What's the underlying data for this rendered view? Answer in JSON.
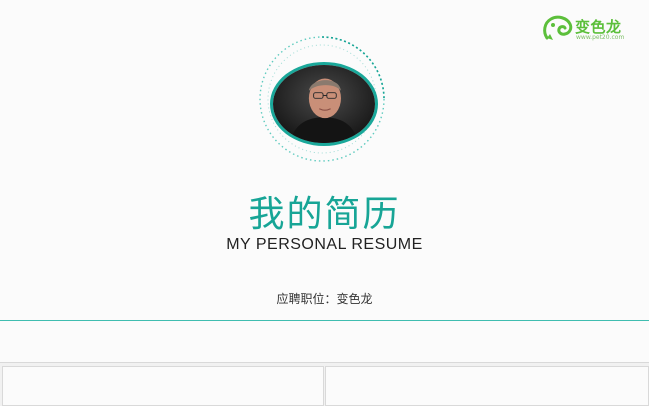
{
  "logo": {
    "name": "变色龙",
    "url": "www.pet20.com",
    "brand_color": "#5cbf3b"
  },
  "header": {
    "title_cn": "我的简历",
    "title_en": "MY PERSONAL RESUME",
    "position": "应聘职位：变色龙"
  },
  "colors": {
    "accent": "#17a596",
    "background": "#fbfbfb"
  }
}
